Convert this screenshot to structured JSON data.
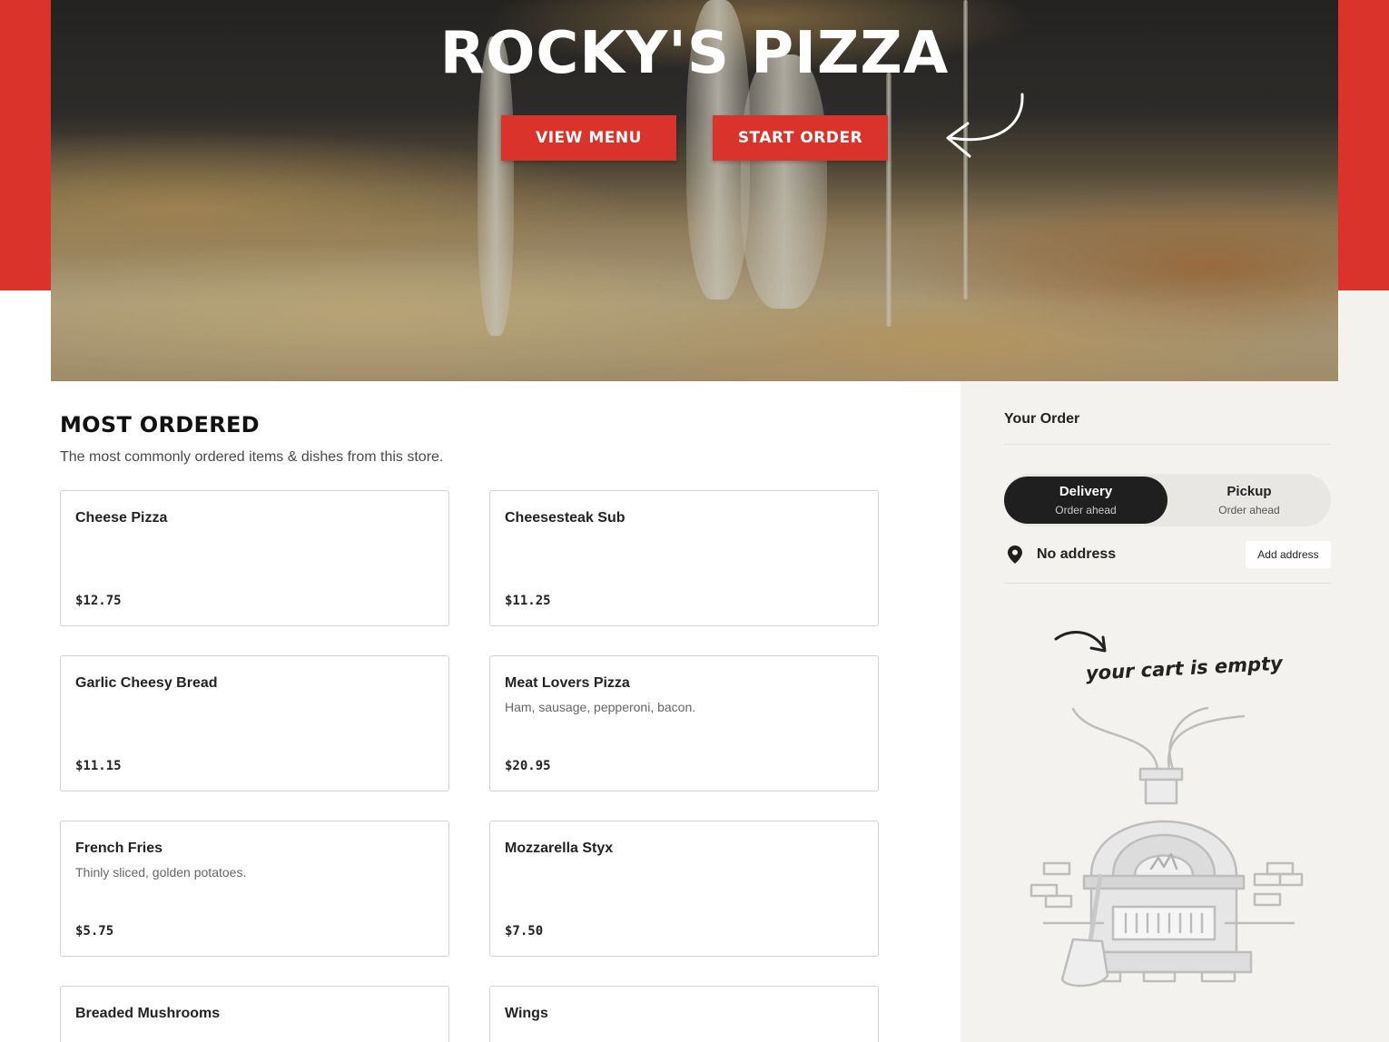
{
  "hero": {
    "title": "ROCKY'S PIZZA",
    "view_menu_label": "VIEW MENU",
    "start_order_label": "START ORDER"
  },
  "colors": {
    "brand_red": "#d9332b",
    "sidebar_bg": "#f3f2ef",
    "toggle_active": "#1f1f1f"
  },
  "most_ordered": {
    "title": "MOST ORDERED",
    "subtitle": "The most commonly ordered items & dishes from this store.",
    "items": [
      {
        "name": "Cheese Pizza",
        "description": "",
        "price": "$12.75"
      },
      {
        "name": "Cheesesteak Sub",
        "description": "",
        "price": "$11.25"
      },
      {
        "name": "Garlic Cheesy Bread",
        "description": "",
        "price": "$11.15"
      },
      {
        "name": "Meat Lovers Pizza",
        "description": "Ham, sausage, pepperoni, bacon.",
        "price": "$20.95"
      },
      {
        "name": "French Fries",
        "description": "Thinly sliced, golden potatoes.",
        "price": "$5.75"
      },
      {
        "name": "Mozzarella Styx",
        "description": "",
        "price": "$7.50"
      },
      {
        "name": "Breaded Mushrooms",
        "description": "",
        "price": ""
      },
      {
        "name": "Wings",
        "description": "",
        "price": ""
      }
    ]
  },
  "order": {
    "title": "Your Order",
    "delivery": {
      "label": "Delivery",
      "sub": "Order ahead",
      "selected": true
    },
    "pickup": {
      "label": "Pickup",
      "sub": "Order ahead",
      "selected": false
    },
    "address_text": "No address",
    "add_address_label": "Add address",
    "empty_cart_text": "your cart is empty"
  },
  "icons": {
    "location": "map-pin-icon",
    "hero_arrow": "curved-arrow-icon",
    "cart_arrow": "curved-arrow-icon",
    "oven": "pizza-oven-illustration"
  }
}
